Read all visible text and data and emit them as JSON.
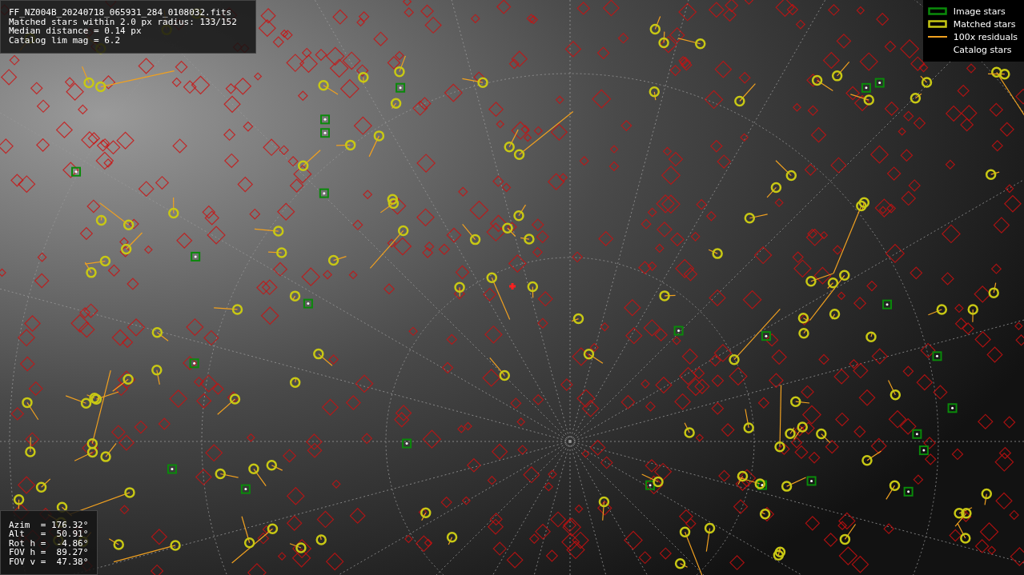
{
  "info_panel": {
    "lines": [
      "FF_NZ004B_20240718_065931_284_0108032.fits",
      "Matched stars within 2.0 px radius: 133/152",
      "Median distance = 0.14 px",
      "Catalog lim mag = 6.2"
    ]
  },
  "legend": [
    {
      "kind": "box",
      "label": "Image stars",
      "color": "#0a8a0a"
    },
    {
      "kind": "box",
      "label": "Matched stars",
      "color": "#c8c814"
    },
    {
      "kind": "line",
      "label": "100x residuals",
      "color": "#f0a020"
    },
    {
      "kind": "none",
      "label": "Catalog stars"
    }
  ],
  "pointing_panel": {
    "lines": [
      "Azim  = 176.32°",
      "Alt   =  50.91°",
      "Rot h =  -4.86°",
      "FOV h =  89.27°",
      "FOV v =  47.38°"
    ]
  }
}
